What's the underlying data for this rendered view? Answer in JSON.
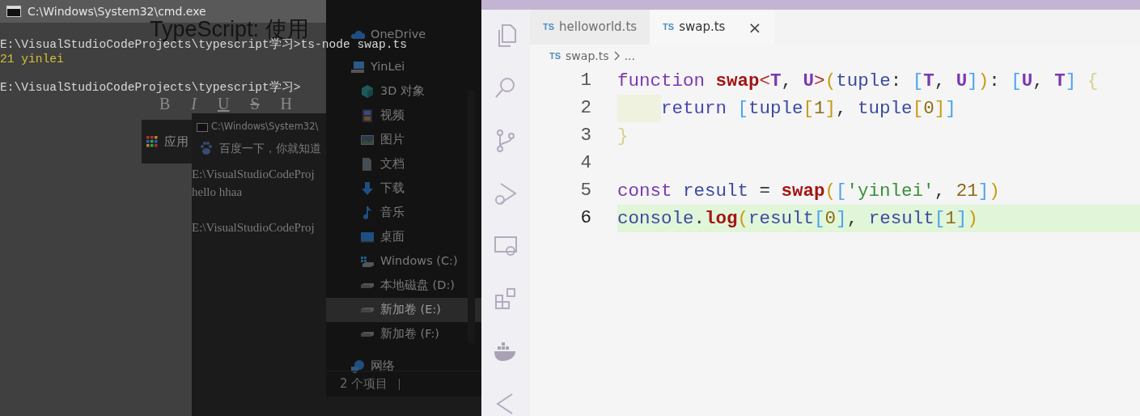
{
  "cmd_window": {
    "title": "C:\\Windows\\System32\\cmd.exe",
    "blocks": [
      [
        "E:\\VisualStudioCodeProjects\\typescript学习>ts-node swap.ts",
        "21 yinlei"
      ],
      [
        "E:\\VisualStudioCodeProjects\\typescript学习>"
      ]
    ]
  },
  "background_page": {
    "heading": "TypeScript: 使用",
    "toolbar": [
      "B",
      "I",
      "U",
      "S",
      "H"
    ],
    "bookmark": "应用"
  },
  "dimmed_browser": {
    "tab_title": "C:\\Windows\\System32\\",
    "bookmark": "百度一下，你就知道",
    "blocks": [
      [
        "E:\\VisualStudioCodeProj",
        "hello hhaa"
      ],
      [
        "E:\\VisualStudioCodeProj"
      ]
    ]
  },
  "explorer": {
    "items": [
      {
        "label": "OneDrive",
        "kind": "cloud",
        "selected": false
      },
      {
        "label": "YinLei",
        "kind": "computer",
        "selected": false,
        "children": [
          {
            "label": "3D 对象",
            "kind": "cube",
            "selected": false
          },
          {
            "label": "视频",
            "kind": "video",
            "selected": false
          },
          {
            "label": "图片",
            "kind": "image",
            "selected": false
          },
          {
            "label": "文档",
            "kind": "document",
            "selected": false
          },
          {
            "label": "下载",
            "kind": "download",
            "selected": false
          },
          {
            "label": "音乐",
            "kind": "music",
            "selected": false
          },
          {
            "label": "桌面",
            "kind": "desktop",
            "selected": false
          },
          {
            "label": "Windows (C:)",
            "kind": "system-drive",
            "selected": false
          },
          {
            "label": "本地磁盘 (D:)",
            "kind": "drive",
            "selected": false
          },
          {
            "label": "新加卷 (E:)",
            "kind": "drive",
            "selected": true
          },
          {
            "label": "新加卷 (F:)",
            "kind": "drive",
            "selected": false
          }
        ]
      },
      {
        "label": "网络",
        "kind": "network",
        "selected": false
      }
    ],
    "status": "2 个项目"
  },
  "vscode": {
    "tabs": [
      {
        "icon_text": "TS",
        "label": "helloworld.ts",
        "selected": false
      },
      {
        "icon_text": "TS",
        "label": "swap.ts",
        "selected": true,
        "close": "×"
      }
    ],
    "breadcrumb": {
      "icon_text": "TS",
      "items": [
        "swap.ts",
        "..."
      ]
    },
    "lines": [
      {
        "number": "1",
        "highlighted": false,
        "indented": false,
        "tokens": [
          {
            "text": "function ",
            "kind": "keyword"
          },
          {
            "text": "swap",
            "kind": "func"
          },
          {
            "text": "<",
            "kind": "angle"
          },
          {
            "text": "T",
            "kind": "type"
          },
          {
            "text": ", ",
            "kind": "plain"
          },
          {
            "text": "U",
            "kind": "type"
          },
          {
            "text": ">",
            "kind": "angle"
          },
          {
            "text": "(",
            "kind": "bracket1"
          },
          {
            "text": "tuple",
            "kind": "var"
          },
          {
            "text": ": ",
            "kind": "plain"
          },
          {
            "text": "[",
            "kind": "bracket2"
          },
          {
            "text": "T",
            "kind": "type"
          },
          {
            "text": ", ",
            "kind": "plain"
          },
          {
            "text": "U",
            "kind": "type"
          },
          {
            "text": "]",
            "kind": "bracket2"
          },
          {
            "text": ")",
            "kind": "bracket1"
          },
          {
            "text": ": ",
            "kind": "plain"
          },
          {
            "text": "[",
            "kind": "bracket2"
          },
          {
            "text": "U",
            "kind": "type"
          },
          {
            "text": ", ",
            "kind": "plain"
          },
          {
            "text": "T",
            "kind": "type"
          },
          {
            "text": "]",
            "kind": "bracket2"
          },
          {
            "text": " {",
            "kind": "brace"
          }
        ]
      },
      {
        "number": "2",
        "highlighted": false,
        "indented": true,
        "tokens": [
          {
            "text": "return ",
            "kind": "control"
          },
          {
            "text": "[",
            "kind": "bracket2"
          },
          {
            "text": "tuple",
            "kind": "var"
          },
          {
            "text": "[",
            "kind": "bracket1"
          },
          {
            "text": "1",
            "kind": "number"
          },
          {
            "text": "]",
            "kind": "bracket1"
          },
          {
            "text": ", ",
            "kind": "plain"
          },
          {
            "text": "tuple",
            "kind": "var"
          },
          {
            "text": "[",
            "kind": "bracket1"
          },
          {
            "text": "0",
            "kind": "number"
          },
          {
            "text": "]",
            "kind": "bracket1"
          },
          {
            "text": "]",
            "kind": "bracket2"
          }
        ]
      },
      {
        "number": "3",
        "highlighted": false,
        "indented": false,
        "tokens": [
          {
            "text": "}",
            "kind": "brace"
          }
        ]
      },
      {
        "number": "4",
        "highlighted": false,
        "indented": false
      },
      {
        "number": "5",
        "highlighted": false,
        "indented": false,
        "tokens": [
          {
            "text": "const ",
            "kind": "keyword"
          },
          {
            "text": "result",
            "kind": "var"
          },
          {
            "text": " = ",
            "kind": "plain"
          },
          {
            "text": "swap",
            "kind": "func"
          },
          {
            "text": "(",
            "kind": "bracket1"
          },
          {
            "text": "[",
            "kind": "bracket2"
          },
          {
            "text": "'yinlei'",
            "kind": "string"
          },
          {
            "text": ", ",
            "kind": "plain"
          },
          {
            "text": "21",
            "kind": "number"
          },
          {
            "text": "]",
            "kind": "bracket2"
          },
          {
            "text": ")",
            "kind": "bracket1"
          }
        ]
      },
      {
        "number": "6",
        "highlighted": true,
        "indented": false,
        "tokens": [
          {
            "text": "console",
            "kind": "var"
          },
          {
            "text": ".",
            "kind": "plain"
          },
          {
            "text": "log",
            "kind": "func"
          },
          {
            "text": "(",
            "kind": "bracket1"
          },
          {
            "text": "result",
            "kind": "var"
          },
          {
            "text": "[",
            "kind": "bracket2"
          },
          {
            "text": "0",
            "kind": "number"
          },
          {
            "text": "]",
            "kind": "bracket2"
          },
          {
            "text": ", ",
            "kind": "plain"
          },
          {
            "text": "result",
            "kind": "var"
          },
          {
            "text": "[",
            "kind": "bracket2"
          },
          {
            "text": "1",
            "kind": "number"
          },
          {
            "text": "]",
            "kind": "bracket2"
          },
          {
            "text": ")",
            "kind": "bracket1"
          }
        ]
      }
    ]
  }
}
